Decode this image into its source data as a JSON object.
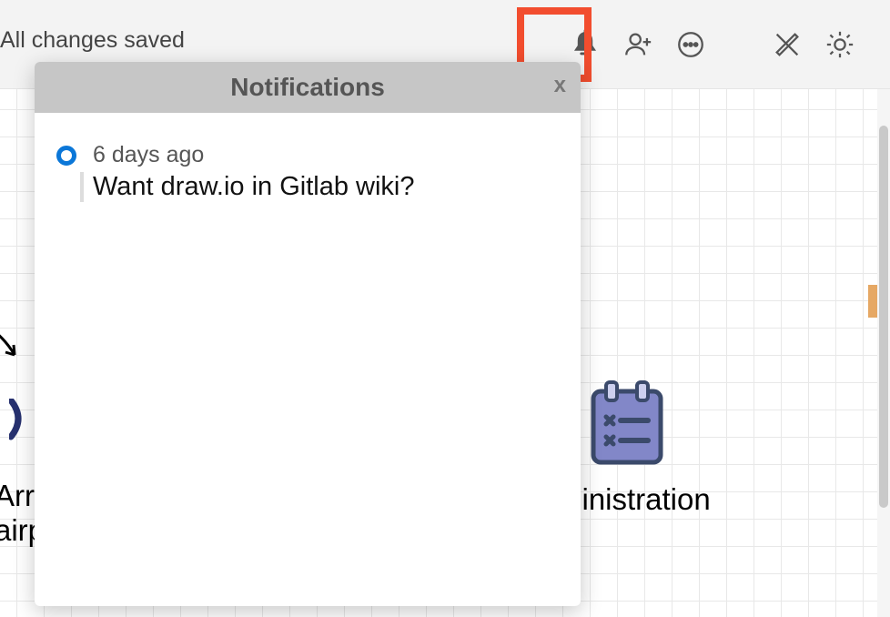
{
  "toolbar": {
    "save_status": "All changes saved",
    "icons": {
      "bell": "bell-icon",
      "share": "person-add-icon",
      "more": "more-horizontal-icon",
      "design": "ruler-pencil-icon",
      "theme": "sun-icon"
    }
  },
  "canvas": {
    "arrival_label_line1": "Arr",
    "arrival_label_line2": "airp",
    "ministration_label": "ministration"
  },
  "notifications": {
    "title": "Notifications",
    "close_label": "x",
    "items": [
      {
        "time": "6 days ago",
        "title": "Want draw.io in Gitlab wiki?"
      }
    ]
  },
  "colors": {
    "highlight": "#f24d2e",
    "unread_dot": "#0b77d8",
    "clipboard_body": "#8287c8",
    "clipboard_outline": "#3b4a6b"
  }
}
